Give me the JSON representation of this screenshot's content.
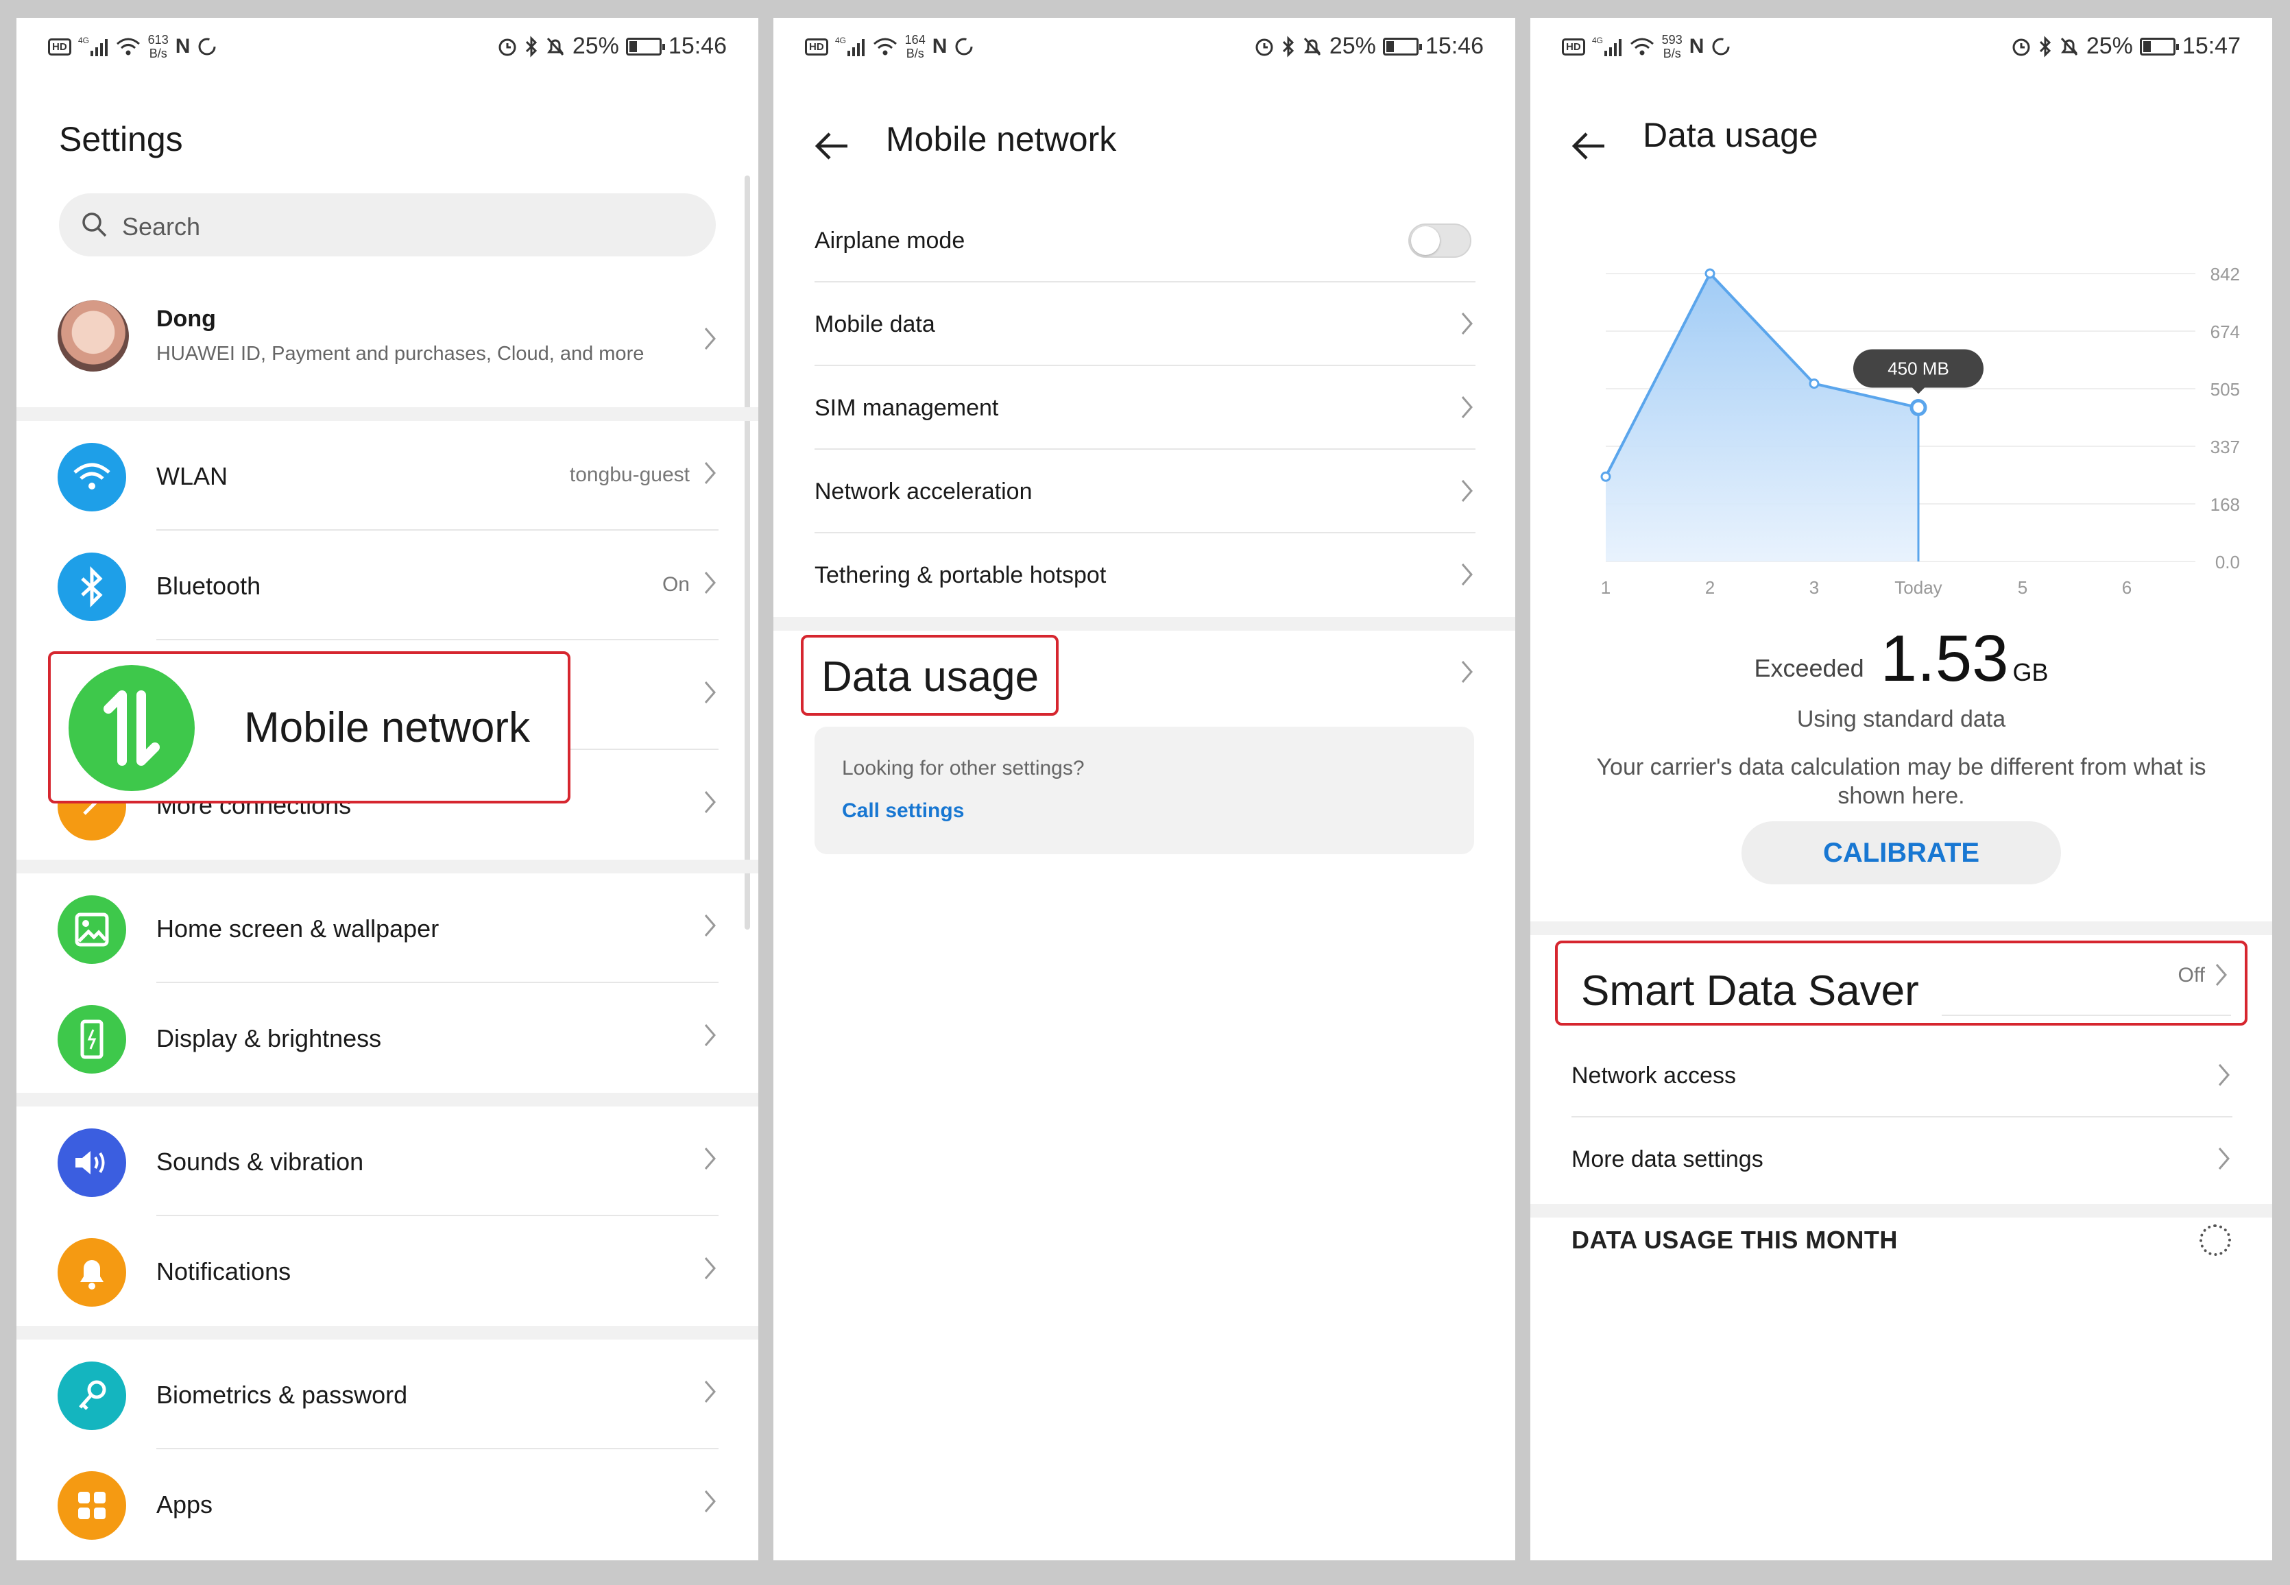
{
  "panel1": {
    "status": {
      "net": "4G",
      "speed_value": "613",
      "speed_unit": "B/s",
      "battery": "25%",
      "time": "15:46"
    },
    "title": "Settings",
    "search_placeholder": "Search",
    "profile": {
      "name": "Dong",
      "subtitle": "HUAWEI ID, Payment and purchases, Cloud, and more"
    },
    "items": [
      {
        "label": "WLAN",
        "value": "tongbu-guest",
        "icon": "wifi-icon",
        "color": "#1e9fe8"
      },
      {
        "label": "Bluetooth",
        "value": "On",
        "icon": "bluetooth-icon",
        "color": "#1e9fe8"
      },
      {
        "label": "Mobile network",
        "value": "",
        "icon": "mobile-data-icon",
        "color": "#3ec84b"
      },
      {
        "label": "More connections",
        "value": "",
        "icon": "link-icon",
        "color": "#f59a12"
      },
      {
        "label": "Home screen & wallpaper",
        "value": "",
        "icon": "image-icon",
        "color": "#3ec84b"
      },
      {
        "label": "Display & brightness",
        "value": "",
        "icon": "display-icon",
        "color": "#3ec84b"
      },
      {
        "label": "Sounds & vibration",
        "value": "",
        "icon": "speaker-icon",
        "color": "#3b5ee0"
      },
      {
        "label": "Notifications",
        "value": "",
        "icon": "bell-icon",
        "color": "#f59a12"
      },
      {
        "label": "Biometrics & password",
        "value": "",
        "icon": "key-icon",
        "color": "#14b5bf"
      },
      {
        "label": "Apps",
        "value": "",
        "icon": "apps-icon",
        "color": "#f59a12"
      }
    ],
    "callout": "Mobile network"
  },
  "panel2": {
    "status": {
      "net": "4G",
      "speed_value": "164",
      "speed_unit": "B/s",
      "battery": "25%",
      "time": "15:46"
    },
    "title": "Mobile network",
    "items": [
      {
        "label": "Airplane mode",
        "toggle": false
      },
      {
        "label": "Mobile data"
      },
      {
        "label": "SIM management"
      },
      {
        "label": "Network acceleration"
      },
      {
        "label": "Tethering & portable hotspot"
      }
    ],
    "data_usage": "Data usage",
    "card": {
      "question": "Looking for other settings?",
      "link": "Call settings"
    }
  },
  "panel3": {
    "status": {
      "net": "4G",
      "speed_value": "593",
      "speed_unit": "B/s",
      "battery": "25%",
      "time": "15:47"
    },
    "title": "Data usage",
    "chart_data": {
      "type": "area",
      "x_labels": [
        "1",
        "2",
        "3",
        "Today",
        "5",
        "6"
      ],
      "y_ticks": [
        "842",
        "674",
        "505",
        "337",
        "168",
        "0.0"
      ],
      "ylim": [
        0,
        842
      ],
      "values": [
        248,
        842,
        520,
        450
      ],
      "tooltip": "450 MB",
      "color": "#5aa5ec"
    },
    "exceeded_label": "Exceeded",
    "exceeded_value": "1.53",
    "exceeded_unit": "GB",
    "plan": "Using standard data",
    "note": "Your carrier's data calculation may be different from what is shown here.",
    "calibrate": "CALIBRATE",
    "smart_saver": {
      "label": "Smart Data Saver",
      "value": "Off"
    },
    "items": [
      {
        "label": "Network access"
      },
      {
        "label": "More data settings"
      }
    ],
    "section": "DATA USAGE THIS MONTH"
  }
}
